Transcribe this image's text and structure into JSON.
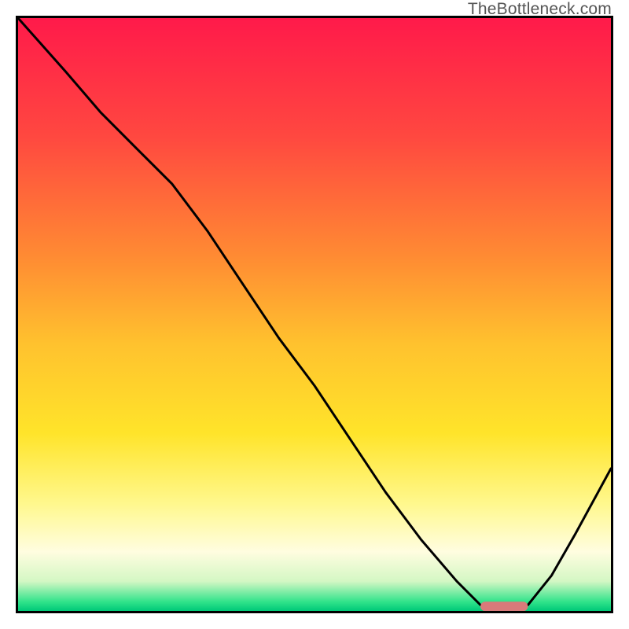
{
  "watermark": "TheBottleneck.com",
  "chart_data": {
    "type": "line",
    "title": "",
    "xlabel": "",
    "ylabel": "",
    "xlim": [
      0,
      100
    ],
    "ylim": [
      0,
      100
    ],
    "x": [
      0,
      8,
      14,
      20,
      26,
      32,
      38,
      44,
      50,
      56,
      62,
      68,
      74,
      78,
      82,
      86,
      90,
      94,
      100
    ],
    "values": [
      100,
      91,
      84,
      78,
      72,
      64,
      55,
      46,
      38,
      29,
      20,
      12,
      5,
      1,
      0,
      1,
      6,
      13,
      24
    ],
    "marker": {
      "x_range": [
        78,
        86
      ],
      "y": 0.5,
      "color": "#d97a7a"
    },
    "background_gradient": {
      "stops": [
        {
          "pos": 0.0,
          "color": "#ff1a4a"
        },
        {
          "pos": 0.2,
          "color": "#ff4840"
        },
        {
          "pos": 0.4,
          "color": "#ff8a33"
        },
        {
          "pos": 0.55,
          "color": "#ffc22e"
        },
        {
          "pos": 0.7,
          "color": "#ffe42a"
        },
        {
          "pos": 0.82,
          "color": "#fff88e"
        },
        {
          "pos": 0.9,
          "color": "#fffde0"
        },
        {
          "pos": 0.95,
          "color": "#d4f7c4"
        },
        {
          "pos": 0.985,
          "color": "#2fe38a"
        },
        {
          "pos": 1.0,
          "color": "#00c878"
        }
      ]
    }
  }
}
